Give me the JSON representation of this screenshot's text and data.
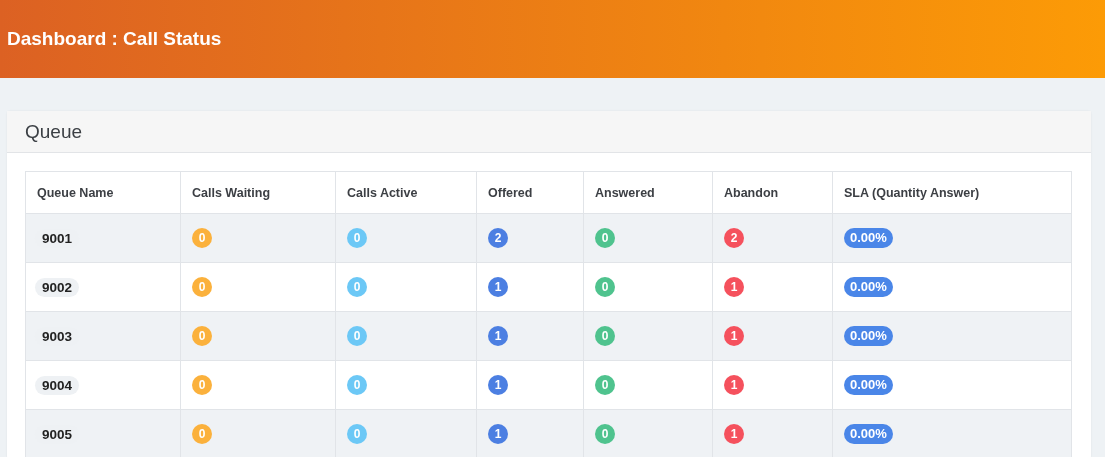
{
  "page_title": "Dashboard : Call Status",
  "card": {
    "title": "Queue",
    "table": {
      "columns": [
        {
          "label": "Queue Name",
          "kind": "name"
        },
        {
          "label": "Calls Waiting",
          "kind": "count",
          "color": "#fbb13c"
        },
        {
          "label": "Calls Active",
          "kind": "count",
          "color": "#6cc8f6"
        },
        {
          "label": "Offered",
          "kind": "count",
          "color": "#4c7fe2"
        },
        {
          "label": "Answered",
          "kind": "count",
          "color": "#4fc38e"
        },
        {
          "label": "Abandon",
          "kind": "count",
          "color": "#f5515d"
        },
        {
          "label": "SLA (Quantity Answer)",
          "kind": "percent",
          "color": "#4a86e8"
        }
      ],
      "rows": [
        {
          "cells": [
            "9001",
            "0",
            "0",
            "2",
            "0",
            "2",
            "0.00%"
          ]
        },
        {
          "cells": [
            "9002",
            "0",
            "0",
            "1",
            "0",
            "1",
            "0.00%"
          ]
        },
        {
          "cells": [
            "9003",
            "0",
            "0",
            "1",
            "0",
            "1",
            "0.00%"
          ]
        },
        {
          "cells": [
            "9004",
            "0",
            "0",
            "1",
            "0",
            "1",
            "0.00%"
          ]
        },
        {
          "cells": [
            "9005",
            "0",
            "0",
            "1",
            "0",
            "1",
            "0.00%"
          ]
        }
      ]
    }
  }
}
